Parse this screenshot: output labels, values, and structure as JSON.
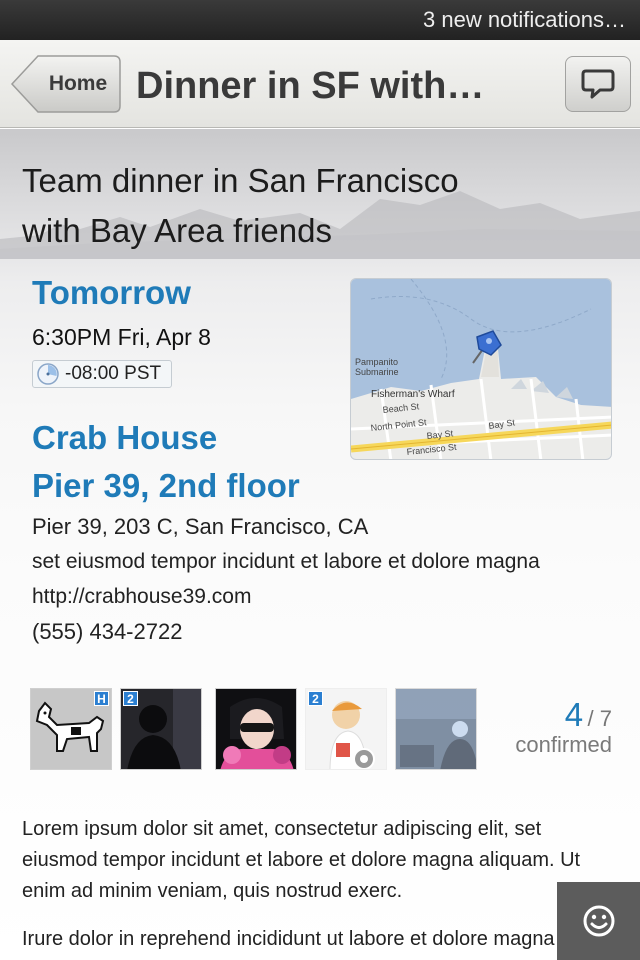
{
  "status_bar": {
    "notifications": "3 new notifications…"
  },
  "nav": {
    "back_label": "Home",
    "title": "Dinner in SF with…"
  },
  "event": {
    "title_line1": "Team dinner in San Francisco",
    "title_line2": "with Bay Area friends",
    "when_label": "Tomorrow",
    "time": "6:30PM Fri, Apr 8",
    "timezone": "-08:00 PST",
    "venue_name": "Crab House",
    "venue_detail": "Pier 39, 2nd floor",
    "address": "Pier 39, 203 C, San Francisco, CA",
    "note": "set eiusmod tempor incidunt et labore et dolore magna",
    "url": "http://crabhouse39.com",
    "phone": "(555) 434-2722"
  },
  "map": {
    "labels": {
      "pampanito_1": "Pampanito",
      "pampanito_2": "Submarine",
      "wharf": "Fisherman's Wharf",
      "beach": "Beach St",
      "north_point": "North Point St",
      "bay_1": "Bay St",
      "bay_2": "Bay St",
      "francisco": "Francisco St"
    }
  },
  "attendees": {
    "avatars": [
      {
        "badge": "H"
      },
      {
        "badge": "2"
      },
      {
        "badge": ""
      },
      {
        "badge": "2"
      },
      {
        "badge": ""
      }
    ],
    "confirmed_count": "4",
    "total": "/ 7",
    "confirmed_label": "confirmed"
  },
  "description": {
    "p1": "Lorem ipsum dolor sit amet, consectetur adipiscing elit, set eiusmod tempor incidunt et labore et dolore magna aliquam. Ut enim ad minim veniam, quis nostrud exerc.",
    "p2": "Irure dolor in reprehend incididunt ut labore et dolore magna"
  },
  "colors": {
    "accent": "#1f7bb8",
    "badge": "#2b7fd1"
  },
  "icons": {
    "back": "back-arrow-icon",
    "chat": "speech-bubble-icon",
    "clock": "clock-icon",
    "pin": "map-pin-icon",
    "smiley": "smiley-icon"
  }
}
